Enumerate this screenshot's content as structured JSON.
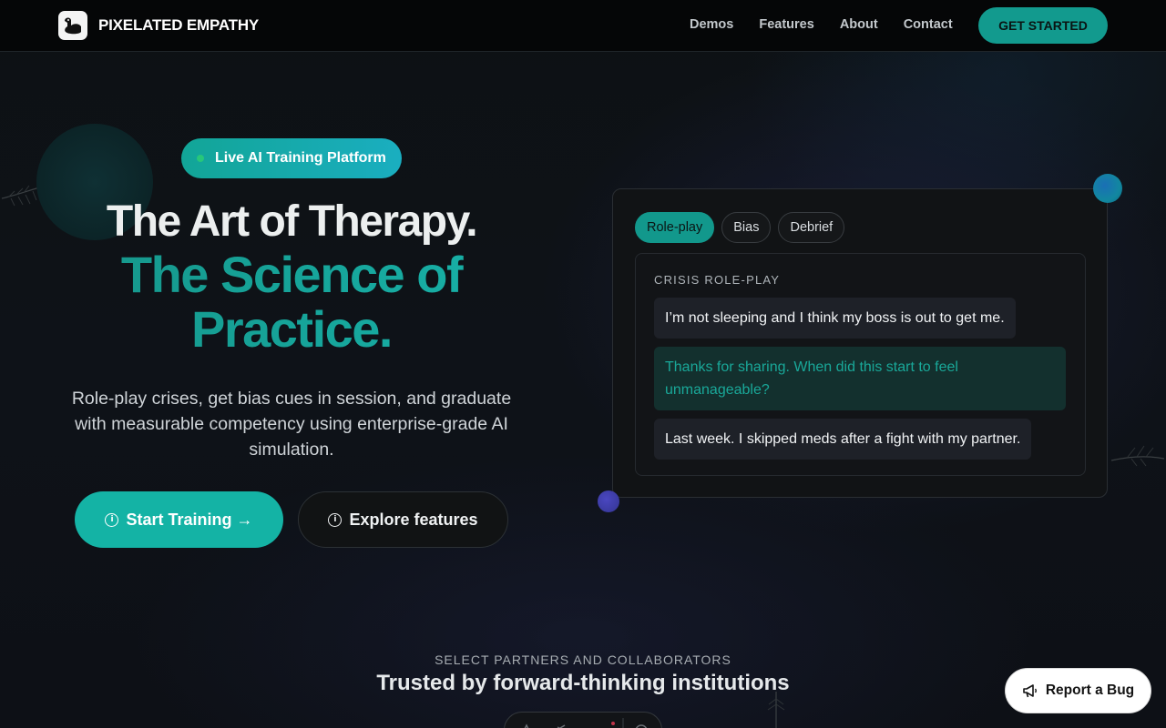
{
  "nav": {
    "brand": "PIXELATED EMPATHY",
    "links": [
      "Demos",
      "Features",
      "About",
      "Contact"
    ],
    "cta": "GET STARTED"
  },
  "hero": {
    "badge": "Live AI Training Platform",
    "title_line1": "The Art of Therapy.",
    "title_line2": "The Science of",
    "title_line3": "Practice.",
    "lead": "Role-play crises, get bias cues in session, and graduate with measurable competency using enterprise-grade AI simulation.",
    "primary_button": "Start Training →",
    "secondary_button": "Explore features"
  },
  "demo_card": {
    "tabs": [
      "Role-play",
      "Bias",
      "Debrief"
    ],
    "active_tab": "Role-play",
    "section_title": "CRISIS ROLE-PLAY",
    "messages": [
      {
        "role": "client",
        "text": "I’m not sleeping and I think my boss is out to get me."
      },
      {
        "role": "therapist",
        "text": "Thanks for sharing. When did this start to feel unmanageable?"
      },
      {
        "role": "client",
        "text": "Last week. I skipped meds after a fight with my partner."
      }
    ]
  },
  "partners": {
    "kicker": "SELECT PARTNERS AND COLLABORATORS",
    "title": "Trusted by forward-thinking institutions"
  },
  "report_bug": "Report a Bug",
  "colors": {
    "accent": "#14b3a5",
    "accent_dark": "#12988c",
    "background": "#0b0f12",
    "nav_bg": "#050607"
  }
}
